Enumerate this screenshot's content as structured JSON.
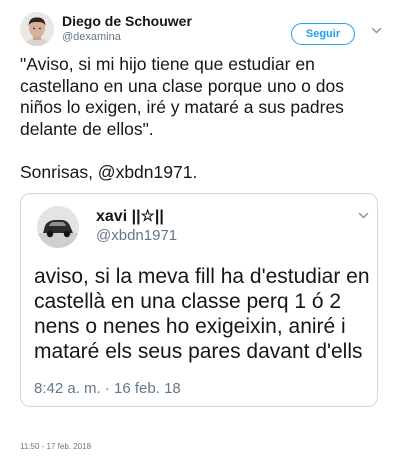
{
  "tweet": {
    "author_name": "Diego de Schouwer",
    "author_handle": "@dexamina",
    "follow_label": "Seguir",
    "menu_icon": "chevron-down-icon",
    "avatar_icon": "avatar",
    "paragraphs": [
      "\"Aviso, si mi hijo tiene que estudiar en castellano en una clase porque uno o dos niños lo exigen, iré y mataré a sus padres delante de ellos\".",
      "Sonrisas, @xbdn1971."
    ],
    "timestamp": "11:50 - 17 feb. 2018"
  },
  "quoted": {
    "author_name": "xavi ||☆||",
    "author_handle": "@xbdn1971",
    "text": "aviso, si la meva fill ha d'estudiar en castellà en una classe perq 1 ó 2 nens o nenes ho exigeixin, aniré i mataré els seus pares davant d'ells",
    "time": "8:42 a. m. · 16 feb. 18",
    "menu_icon": "chevron-down-icon",
    "avatar_icon": "avatar"
  },
  "colors": {
    "accent": "#1da1f2",
    "text": "#14171a",
    "secondary": "#657786",
    "border": "#ccd6dd"
  }
}
